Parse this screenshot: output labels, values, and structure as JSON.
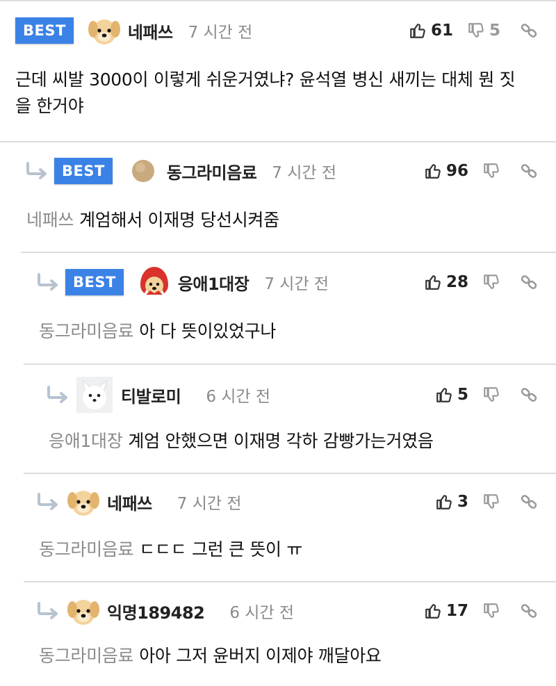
{
  "comments": [
    {
      "best": "BEST",
      "nick": "네패쓰",
      "time": "7 시간 전",
      "likes": "61",
      "dislikes": "5",
      "text": "근데 씨발 3000이 이렇게 쉬운거였냐? 윤석열 병신 새끼는 대체 뭔 짓을 한거야",
      "avatar": "puppy-icon"
    },
    {
      "best": "BEST",
      "nick": "동그라미음료",
      "time": "7 시간 전",
      "likes": "96",
      "mention": "네패쓰",
      "text": "계엄해서 이재명 당선시켜줌",
      "avatar": "circle-icon"
    },
    {
      "best": "BEST",
      "nick": "응애1대장",
      "time": "7 시간 전",
      "likes": "28",
      "mention": "동그라미음료",
      "text": "아 다 뜻이있었구나",
      "avatar": "red-hood-puppy-icon"
    },
    {
      "nick": "티발로미",
      "time": "6 시간 전",
      "likes": "5",
      "mention": "응애1대장",
      "text": "계엄 안했으면 이재명 각하 감빵가는거였음",
      "avatar": "white-dog-icon"
    },
    {
      "nick": "네패쓰",
      "time": "7 시간 전",
      "likes": "3",
      "mention": "동그라미음료",
      "text": "ㄷㄷㄷ 그런 큰 뜻이 ㅠ",
      "avatar": "puppy-icon"
    },
    {
      "nick": "익명189482",
      "time": "6 시간 전",
      "likes": "17",
      "mention": "동그라미음료",
      "text": "아아 그저 윤버지 이제야 깨달아요",
      "avatar": "puppy-icon"
    }
  ],
  "colors": {
    "best": "#3b82e6",
    "muted": "#8a8a8a",
    "divider": "#dcdcdc"
  }
}
